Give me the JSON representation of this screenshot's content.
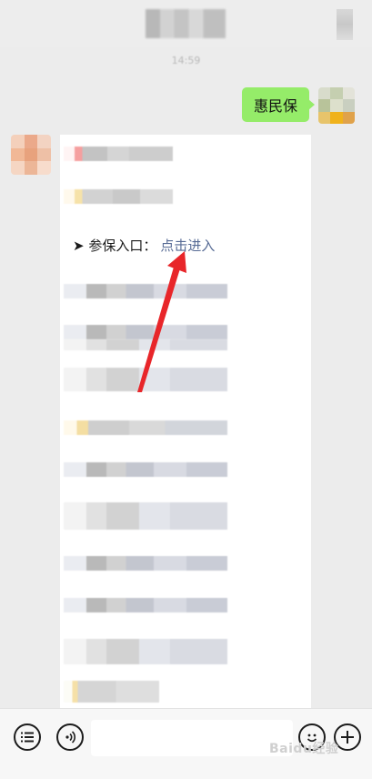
{
  "chat": {
    "time": "14:59",
    "sent_message": "惠民保",
    "entry_prefix": "➤ 参保入口：",
    "entry_link": "点击进入"
  },
  "input": {
    "placeholder": ""
  },
  "watermark": "Baidu经验",
  "colors": {
    "sent_bubble": "#95ec69",
    "link": "#576b95",
    "annotation_arrow": "#e8262a"
  },
  "icons": {
    "left_1": "list-icon",
    "left_2": "voice-icon",
    "right_1": "emoji-icon",
    "right_2": "plus-icon"
  }
}
